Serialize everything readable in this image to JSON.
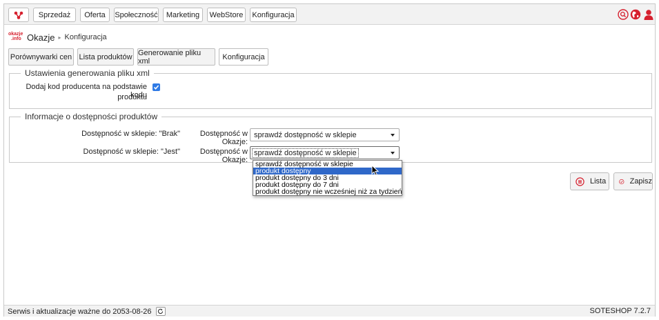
{
  "menu": {
    "items": [
      {
        "label": "Sprzedaż"
      },
      {
        "label": "Oferta"
      },
      {
        "label": "Społeczność"
      },
      {
        "label": "Marketing"
      },
      {
        "label": "WebStore"
      },
      {
        "label": "Konfiguracja"
      }
    ],
    "icons": [
      "search-icon",
      "globe-icon",
      "user-icon"
    ],
    "accent": "#d6202e"
  },
  "breadcrumb": {
    "brand_top": "okazje",
    "brand_bottom": ".info",
    "title": "Okazje",
    "separator": "▸",
    "current": "Konfiguracja"
  },
  "tabs": [
    {
      "label": "Porównywarki cen",
      "active": false
    },
    {
      "label": "Lista produktów",
      "active": false
    },
    {
      "label": "Generowanie pliku xml",
      "active": false
    },
    {
      "label": "Konfiguracja",
      "active": true
    }
  ],
  "section_xml": {
    "legend": "Ustawienia generowania pliku xml",
    "checkbox_label_line1": "Dodaj kod producenta na podstawie kodu",
    "checkbox_label_line2": "produktu",
    "checked": true
  },
  "section_availability": {
    "legend": "Informacje o dostępności produktów",
    "rows": [
      {
        "shop_label": "Dostępność w sklepie: \"Brak\"",
        "okazje_label": "Dostępność w Okazje:",
        "value": "sprawdź dostępność w sklepie"
      },
      {
        "shop_label": "Dostępność w sklepie: \"Jest\"",
        "okazje_label": "Dostępność w Okazje:",
        "value": "sprawdź dostępność w sklepie"
      }
    ],
    "options": [
      "sprawdź dostępność w sklepie",
      "produkt dostępny",
      "produkt dostępny do 3 dni",
      "produkt dostępny do 7 dni",
      "produkt dostępny nie wcześniej niż za tydzień"
    ],
    "highlighted_option": "produkt dostępny"
  },
  "actions": {
    "list_label": "Lista",
    "save_label": "Zapisz"
  },
  "footer": {
    "license": "Serwis i aktualizacje ważne do 2053-08-26",
    "version": "SOTESHOP 7.2.7"
  }
}
